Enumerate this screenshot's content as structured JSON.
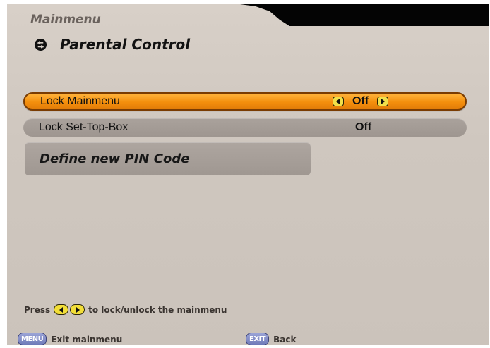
{
  "header": {
    "breadcrumb": "Mainmenu",
    "title": "Parental Control",
    "back_icon": "back-arrow-icon"
  },
  "menu": {
    "items": [
      {
        "label": "Lock Mainmenu",
        "value": "Off",
        "selected": true
      },
      {
        "label": "Lock Set-Top-Box",
        "value": "Off",
        "selected": false
      }
    ],
    "pin_button": "Define new PIN Code"
  },
  "hint": {
    "prefix": "Press",
    "suffix": "to lock/unlock the mainmenu"
  },
  "footer": {
    "menu_key": "MENU",
    "menu_label": "Exit mainmenu",
    "exit_key": "EXIT",
    "exit_label": "Back"
  },
  "colors": {
    "selected_row": "#f48f0d",
    "panel_bg": "#d8d0c8",
    "row_bg": "#a39b95",
    "arrow_key": "#f1e04a",
    "remote_key": "#7b85c4"
  }
}
